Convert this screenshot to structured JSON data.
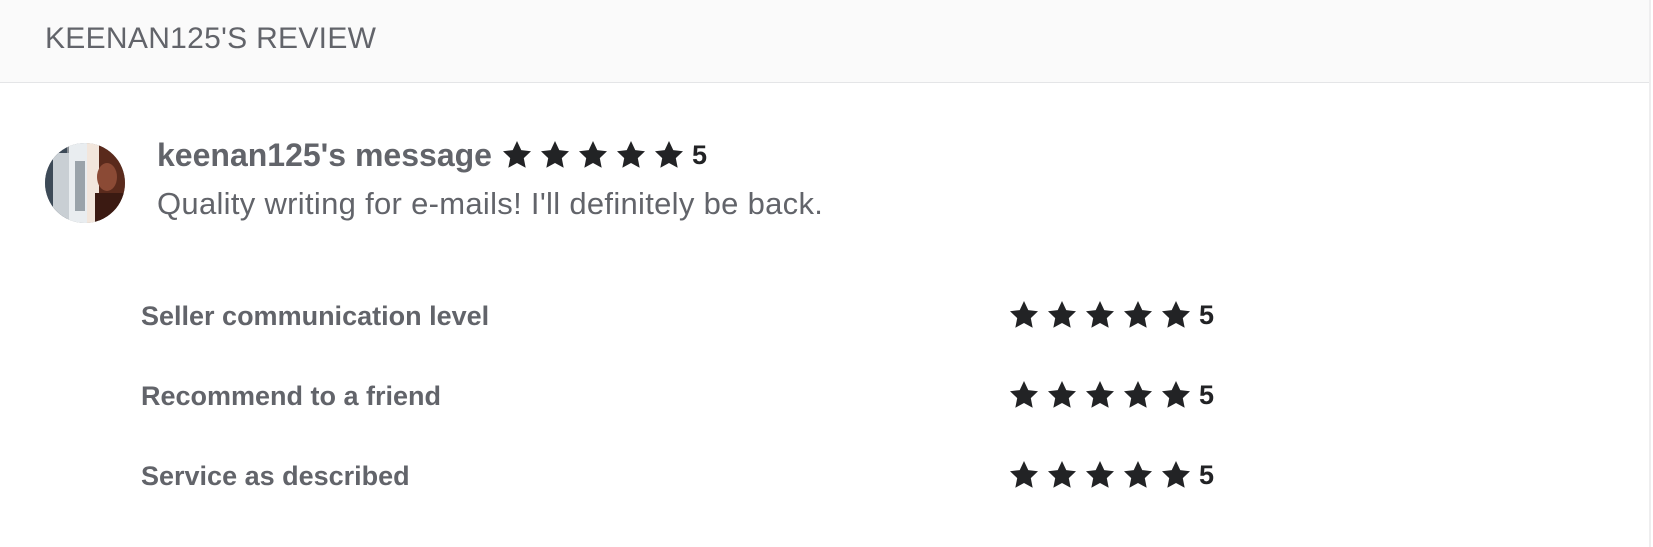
{
  "header": {
    "title": "KEENAN125'S REVIEW"
  },
  "review": {
    "avatar_icon": "user-avatar",
    "username_label": "keenan125's message",
    "rating": 5,
    "rating_text": "5",
    "message": "Quality writing for e-mails! I'll definitely be back."
  },
  "criteria": [
    {
      "label": "Seller communication level",
      "rating": 5,
      "rating_text": "5"
    },
    {
      "label": "Recommend to a friend",
      "rating": 5,
      "rating_text": "5"
    },
    {
      "label": "Service as described",
      "rating": 5,
      "rating_text": "5"
    }
  ],
  "colors": {
    "text_muted": "#62646a",
    "star": "#222325",
    "header_bg": "#fafafa",
    "divider": "#e4e5e7"
  },
  "icons": {
    "star": "star-icon"
  }
}
